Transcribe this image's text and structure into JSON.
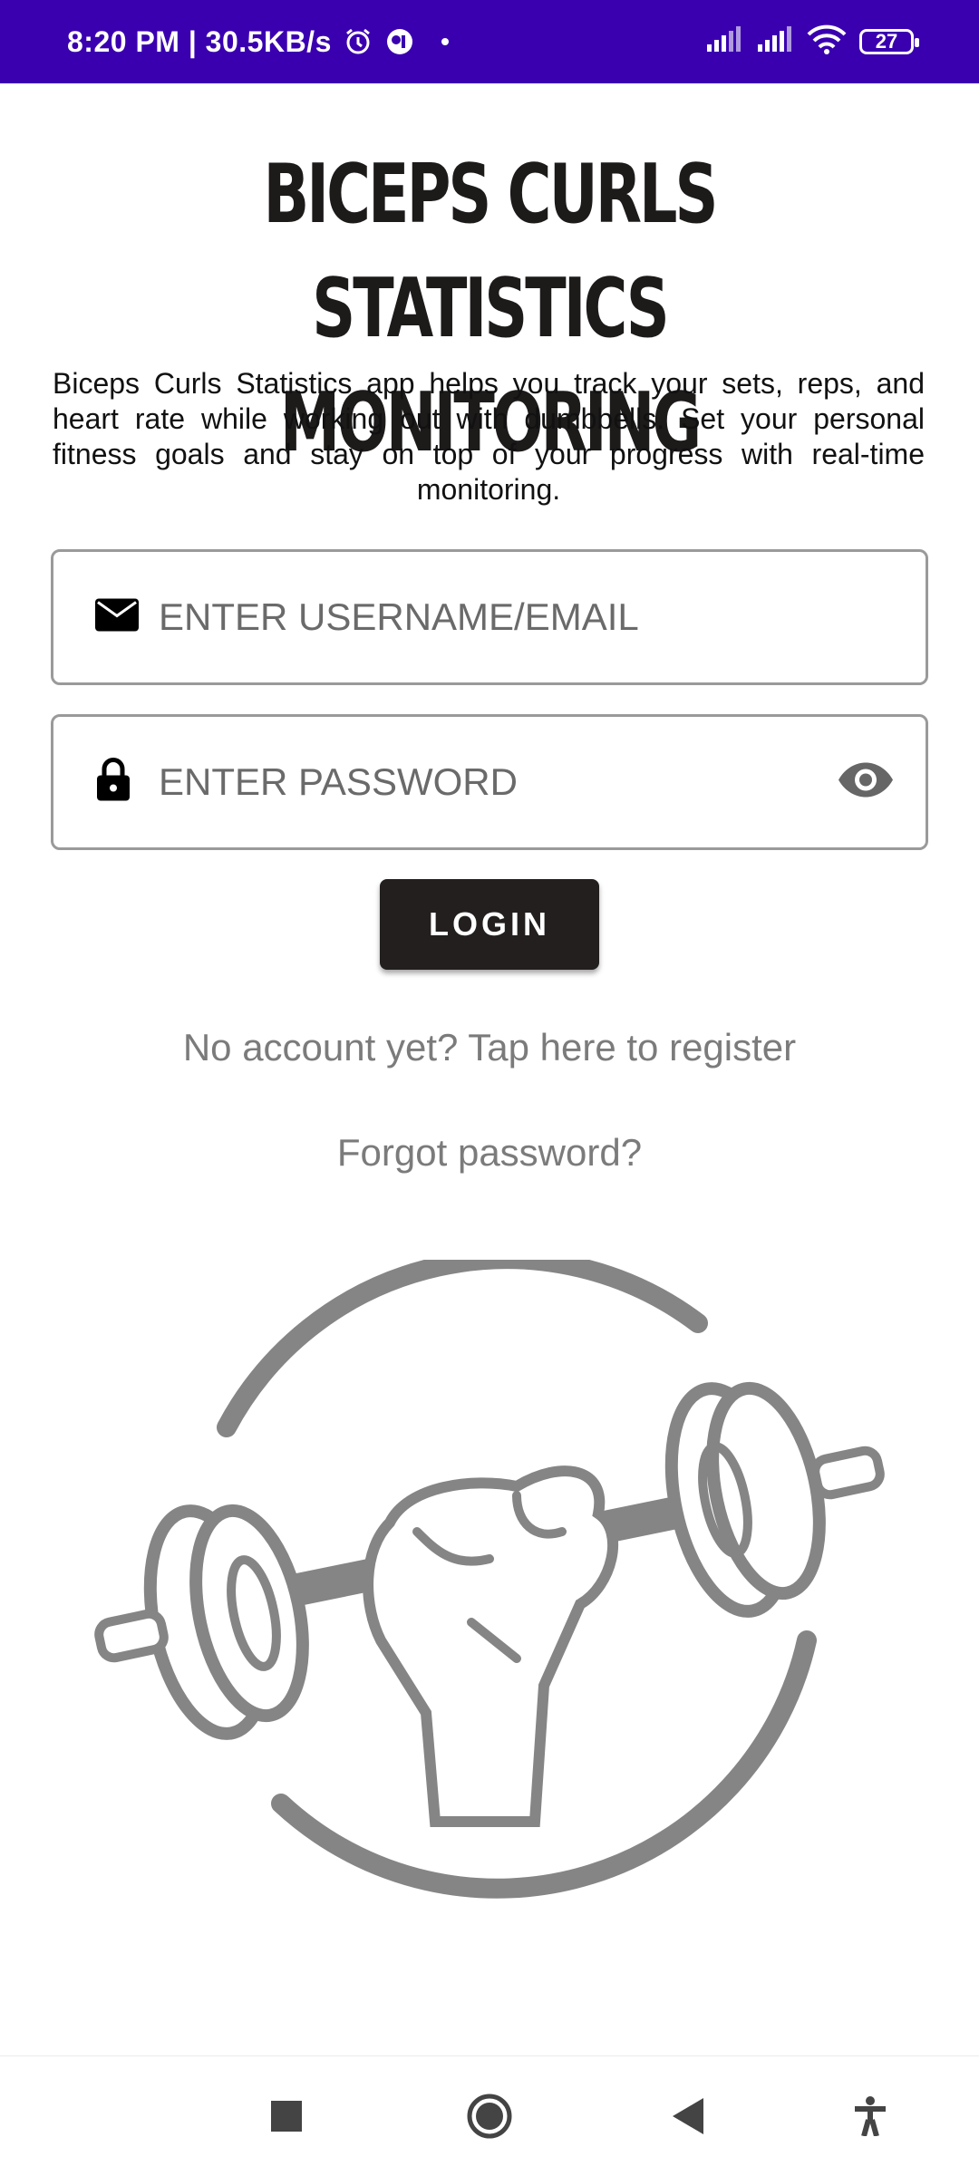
{
  "status_bar": {
    "time_speed": "8:20 PM | 30.5KB/s",
    "battery": "27",
    "icons": [
      "alarm-icon",
      "app-icon",
      "dot-icon",
      "signal-icon",
      "signal-icon",
      "wifi-icon",
      "battery-icon"
    ]
  },
  "app": {
    "title": "BICEPS CURLS STATISTICS MONITORING",
    "description": "Biceps Curls Statistics app helps you track your sets, reps, and heart rate while working out with dumbbells. Set your personal fitness goals and stay on top of your progress with real-time monitoring."
  },
  "form": {
    "username_placeholder": "ENTER USERNAME/EMAIL",
    "username_value": "",
    "password_placeholder": "ENTER PASSWORD",
    "password_value": "",
    "login_label": "LOGIN"
  },
  "links": {
    "register": "No account yet? Tap here to register",
    "forgot": "Forgot password?"
  },
  "nav": {
    "items": [
      "recents-icon",
      "home-icon",
      "back-icon",
      "accessibility-icon"
    ]
  },
  "colors": {
    "status_bar": "#3a00b0",
    "button": "#231f1f",
    "link": "#7b7b7b",
    "logo": "#858585"
  }
}
